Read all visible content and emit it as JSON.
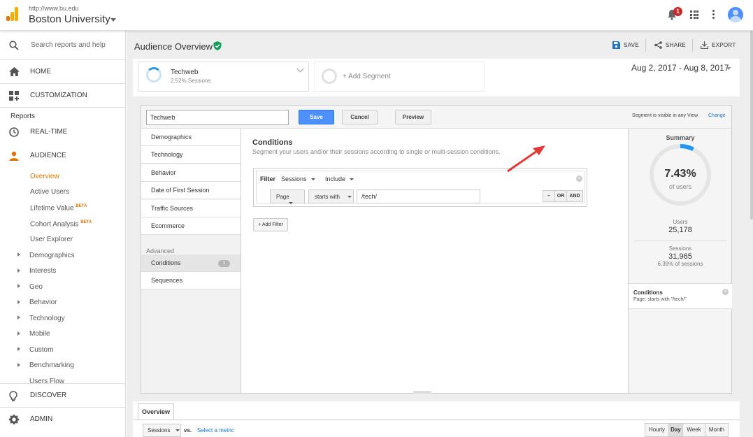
{
  "account": {
    "url": "http://www.bu.edu",
    "name": "Boston University"
  },
  "notifications": {
    "count": "1"
  },
  "sidebar": {
    "search_placeholder": "Search reports and help",
    "home": "HOME",
    "customization": "CUSTOMIZATION",
    "reports_heading": "Reports",
    "realtime": "REAL-TIME",
    "audience": "AUDIENCE",
    "audience_items": [
      "Overview",
      "Active Users",
      "Lifetime Value",
      "Cohort Analysis",
      "User Explorer"
    ],
    "beta": "BETA",
    "expandable_items": [
      "Demographics",
      "Interests",
      "Geo",
      "Behavior",
      "Technology",
      "Mobile",
      "Custom",
      "Benchmarking",
      "Users Flow"
    ],
    "discover": "DISCOVER",
    "admin": "ADMIN"
  },
  "header": {
    "title": "Audience Overview",
    "save": "SAVE",
    "share": "SHARE",
    "export": "EXPORT"
  },
  "segments": {
    "active_name": "Techweb",
    "active_sub": "2.52% Sessions",
    "add_label": "+ Add Segment",
    "date_range": "Aug 2, 2017 - Aug 8, 2017"
  },
  "editor": {
    "name_value": "Techweb",
    "save": "Save",
    "cancel": "Cancel",
    "preview": "Preview",
    "visibility": "Segment is visible in any View",
    "change": "Change",
    "nav": [
      "Demographics",
      "Technology",
      "Behavior",
      "Date of First Session",
      "Traffic Sources",
      "Ecommerce"
    ],
    "advanced": "Advanced",
    "conditions": "Conditions",
    "conditions_count": "1",
    "sequences": "Sequences",
    "cond_title": "Conditions",
    "cond_sub": "Segment your users and/or their sessions according to single or multi-session conditions.",
    "filter": {
      "label": "Filter",
      "scope": "Sessions",
      "mode": "Include",
      "dimension": "Page",
      "operator": "starts with",
      "value": "/tech/",
      "ops": [
        "–",
        "OR",
        "AND"
      ]
    },
    "add_filter": "+ Add Filter",
    "summary": {
      "title": "Summary",
      "percent": "7.43%",
      "percent_value": 0.0743,
      "of_users": "of users",
      "users_label": "Users",
      "users_value": "25,178",
      "sessions_label": "Sessions",
      "sessions_value": "31,965",
      "sessions_pct": "6.39% of sessions",
      "cond_title": "Conditions",
      "cond_desc": "Page: starts with \"/tech/\""
    }
  },
  "overview": {
    "tab": "Overview",
    "metric": "Sessions",
    "vs": "vs.",
    "select_metric": "Select a metric",
    "periods": [
      "Hourly",
      "Day",
      "Week",
      "Month"
    ],
    "active_period": "Day"
  },
  "colors": {
    "accent_blue": "#4d90fe",
    "ga_orange": "#e37400",
    "gauge_blue": "#2196f3",
    "verified_green": "#0f9d58",
    "arrow_red": "#e53935"
  }
}
